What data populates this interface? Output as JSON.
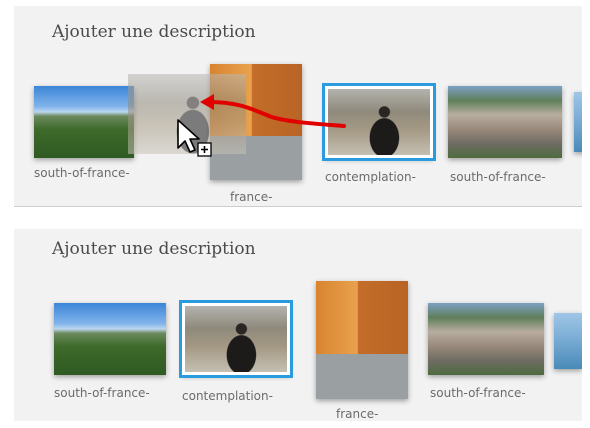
{
  "top": {
    "description": "Ajouter une description",
    "captions": {
      "south_1": "south-of-france-",
      "france": "france-",
      "contemplation": "contemplation-",
      "south_2": "south-of-france-"
    }
  },
  "bottom": {
    "description": "Ajouter une description",
    "captions": {
      "south_1": "south-of-france-",
      "contemplation": "contemplation-",
      "france": "france-",
      "south_2": "south-of-france-"
    }
  },
  "colors": {
    "selection": "#2b9be0",
    "drag_arrow": "#e00000"
  },
  "icons": {
    "cursor": "pointer-arrow-icon",
    "copy": "plus-box-icon"
  }
}
